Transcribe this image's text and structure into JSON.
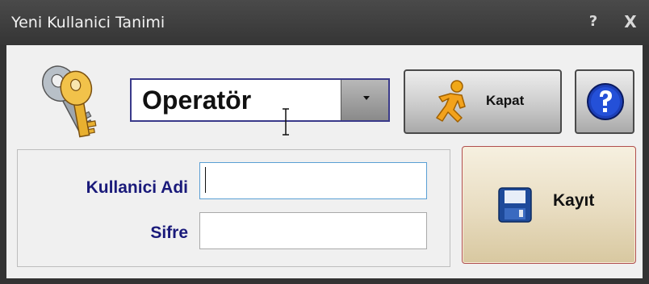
{
  "window": {
    "title": "Yeni Kullanici Tanimi",
    "help_glyph": "?",
    "close_glyph": "X"
  },
  "role_combo": {
    "selected": "Operatör"
  },
  "buttons": {
    "kapat": {
      "label": "Kapat",
      "icon": "running-man-icon"
    },
    "help": {
      "icon": "help-icon"
    },
    "kayit": {
      "label": "Kayıt",
      "icon": "floppy-disk-icon"
    }
  },
  "form": {
    "username": {
      "label": "Kullanici Adi",
      "value": ""
    },
    "password": {
      "label": "Sifre",
      "value": ""
    }
  },
  "colors": {
    "label_text": "#1a1a7a",
    "title_bar": "#3c3c3c",
    "save_button_border": "#b05050"
  }
}
